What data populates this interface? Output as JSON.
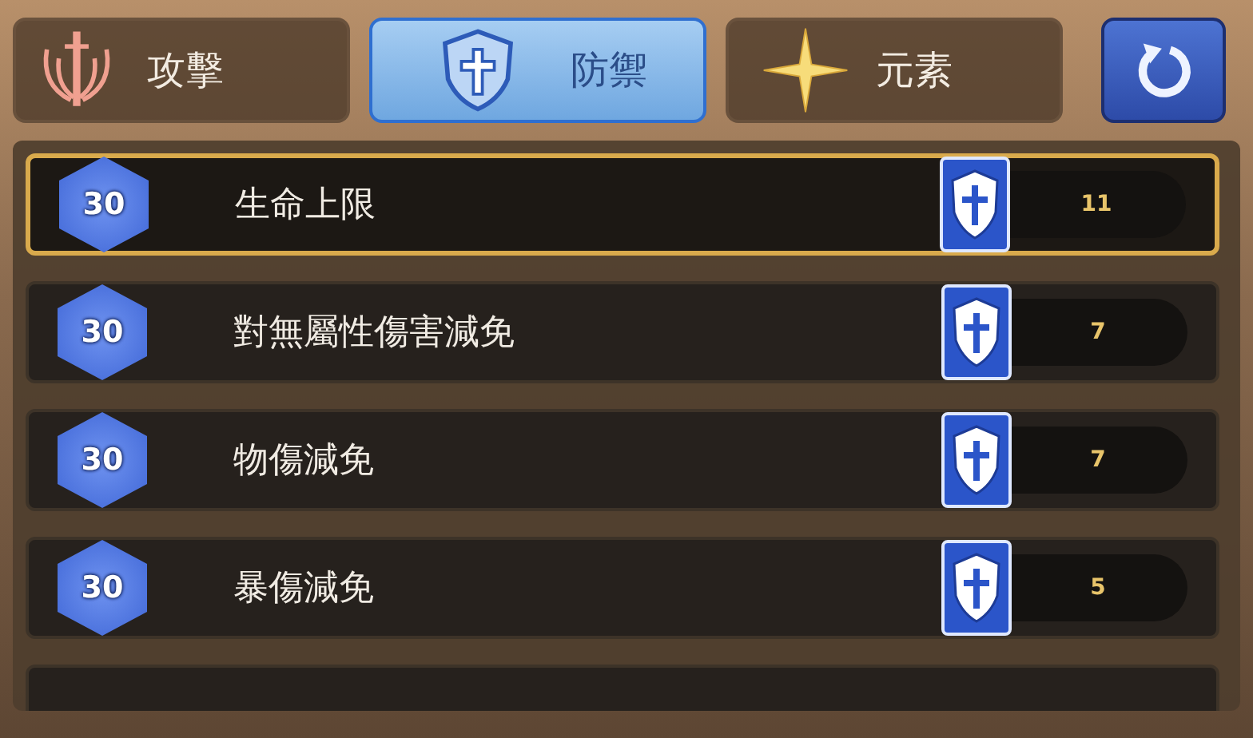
{
  "tabs": [
    {
      "kind": "sword",
      "label": "攻擊",
      "selected": false
    },
    {
      "kind": "shield",
      "label": "防禦",
      "selected": true
    },
    {
      "kind": "star",
      "label": "元素",
      "selected": false
    }
  ],
  "stats": [
    {
      "level": "30",
      "name": "生命上限",
      "value": "11",
      "selected": true
    },
    {
      "level": "30",
      "name": "對無屬性傷害減免",
      "value": "7",
      "selected": false
    },
    {
      "level": "30",
      "name": "物傷減免",
      "value": "7",
      "selected": false
    },
    {
      "level": "30",
      "name": "暴傷減免",
      "value": "5",
      "selected": false
    }
  ]
}
